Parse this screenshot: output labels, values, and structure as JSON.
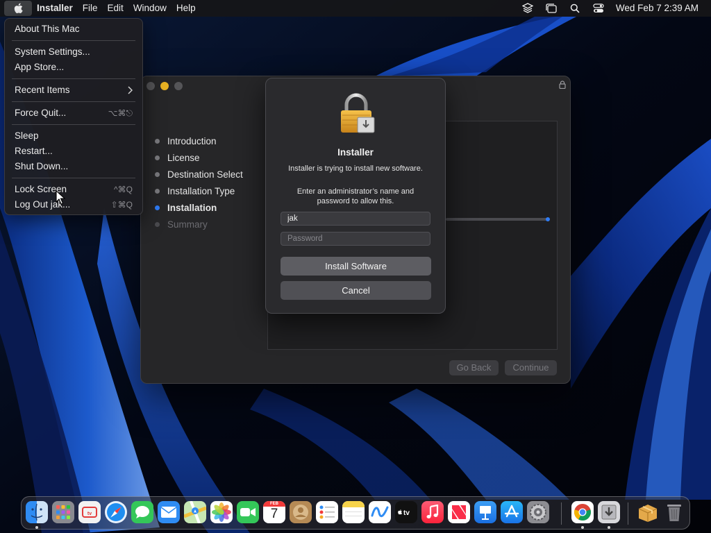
{
  "menubar": {
    "app_name": "Installer",
    "menus": [
      "File",
      "Edit",
      "Window",
      "Help"
    ],
    "clock": "Wed Feb 7  2:39 AM",
    "status_icons": [
      "layers-icon",
      "stage-manager-icon",
      "search-icon",
      "control-center-icon"
    ]
  },
  "apple_menu": {
    "about": "About This Mac",
    "system_settings": "System Settings...",
    "app_store": "App Store...",
    "recent_items": "Recent Items",
    "force_quit": "Force Quit...",
    "force_quit_shortcut": "⌥⌘⎋",
    "sleep": "Sleep",
    "restart": "Restart...",
    "shut_down": "Shut Down...",
    "lock_screen": "Lock Screen",
    "lock_screen_shortcut": "^⌘Q",
    "log_out": "Log Out jak...",
    "log_out_shortcut": "⇧⌘Q"
  },
  "installer": {
    "steps": [
      {
        "label": "Introduction",
        "state": "done"
      },
      {
        "label": "License",
        "state": "done"
      },
      {
        "label": "Destination Select",
        "state": "done"
      },
      {
        "label": "Installation Type",
        "state": "done"
      },
      {
        "label": "Installation",
        "state": "active"
      },
      {
        "label": "Summary",
        "state": "pending"
      }
    ],
    "go_back": "Go Back",
    "continue": "Continue"
  },
  "auth_dialog": {
    "title": "Installer",
    "message": "Installer is trying to install new software.",
    "prompt": "Enter an administrator’s name and password to allow this.",
    "username_value": "jak",
    "password_placeholder": "Password",
    "install_button": "Install Software",
    "cancel_button": "Cancel"
  },
  "dock": {
    "apps": [
      {
        "name": "finder-icon",
        "running": true
      },
      {
        "name": "launchpad-icon",
        "running": false
      },
      {
        "name": "tv-remote-icon",
        "running": false
      },
      {
        "name": "safari-icon",
        "running": false
      },
      {
        "name": "messages-icon",
        "running": false
      },
      {
        "name": "mail-icon",
        "running": false
      },
      {
        "name": "maps-icon",
        "running": false
      },
      {
        "name": "photos-icon",
        "running": false
      },
      {
        "name": "facetime-icon",
        "running": false
      },
      {
        "name": "calendar-icon",
        "running": false
      },
      {
        "name": "contacts-icon",
        "running": false
      },
      {
        "name": "reminders-icon",
        "running": false
      },
      {
        "name": "notes-icon",
        "running": false
      },
      {
        "name": "freeform-icon",
        "running": false
      },
      {
        "name": "apple-tv-icon",
        "running": false
      },
      {
        "name": "music-icon",
        "running": false
      },
      {
        "name": "news-icon",
        "running": false
      },
      {
        "name": "keynote-icon",
        "running": false
      },
      {
        "name": "app-store-icon",
        "running": false
      },
      {
        "name": "system-settings-icon",
        "running": false
      },
      {
        "name": "chrome-icon",
        "running": true
      },
      {
        "name": "installer-icon",
        "running": true
      },
      {
        "name": "package-icon",
        "running": false
      },
      {
        "name": "trash-icon",
        "running": false
      }
    ],
    "calendar_month": "FEB",
    "calendar_day": "7",
    "tv_label": "tv"
  }
}
